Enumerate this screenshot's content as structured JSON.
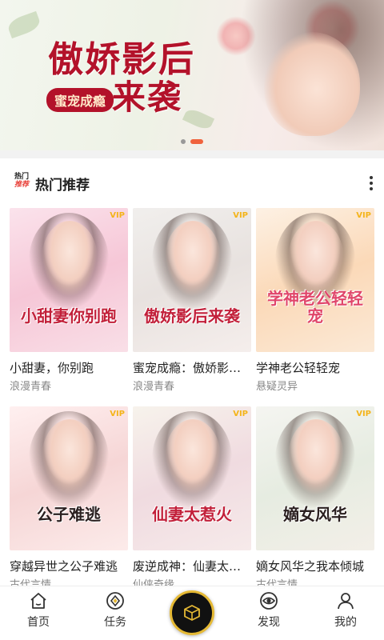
{
  "banner": {
    "title_line1": "傲娇影后",
    "title_line2": "来袭",
    "subtitle": "蜜宠成瘾",
    "page_count": 2,
    "active_page": 2
  },
  "section": {
    "badge_top": "热门",
    "badge_bottom": "推荐",
    "title": "热门推荐"
  },
  "books": [
    {
      "name": "小甜妻，你别跑",
      "genre": "浪漫青春",
      "cover_text": "小甜妻你别跑",
      "cover_tag": "VIP"
    },
    {
      "name": "蜜宠成瘾：傲娇影后来袭",
      "genre": "浪漫青春",
      "cover_text": "傲娇影后来袭",
      "cover_tag": "VIP"
    },
    {
      "name": "学神老公轻轻宠",
      "genre": "悬疑灵异",
      "cover_text": "学神老公轻轻宠",
      "cover_tag": "VIP"
    },
    {
      "name": "穿越异世之公子难逃",
      "genre": "古代言情",
      "cover_text": "公子难逃",
      "cover_tag": "VIP"
    },
    {
      "name": "废逆成神：仙妻太惹火",
      "genre": "仙侠奇缘",
      "cover_text": "仙妻太惹火",
      "cover_tag": "VIP"
    },
    {
      "name": "嫡女风华之我本倾城",
      "genre": "古代言情",
      "cover_text": "嫡女风华",
      "cover_tag": "VIP"
    }
  ],
  "nav": {
    "home": "首页",
    "tasks": "任务",
    "discover": "发现",
    "mine": "我的"
  },
  "colors": {
    "accent": "#f0623c",
    "badge_red": "#e8413a",
    "center_ring": "#e5b934"
  }
}
